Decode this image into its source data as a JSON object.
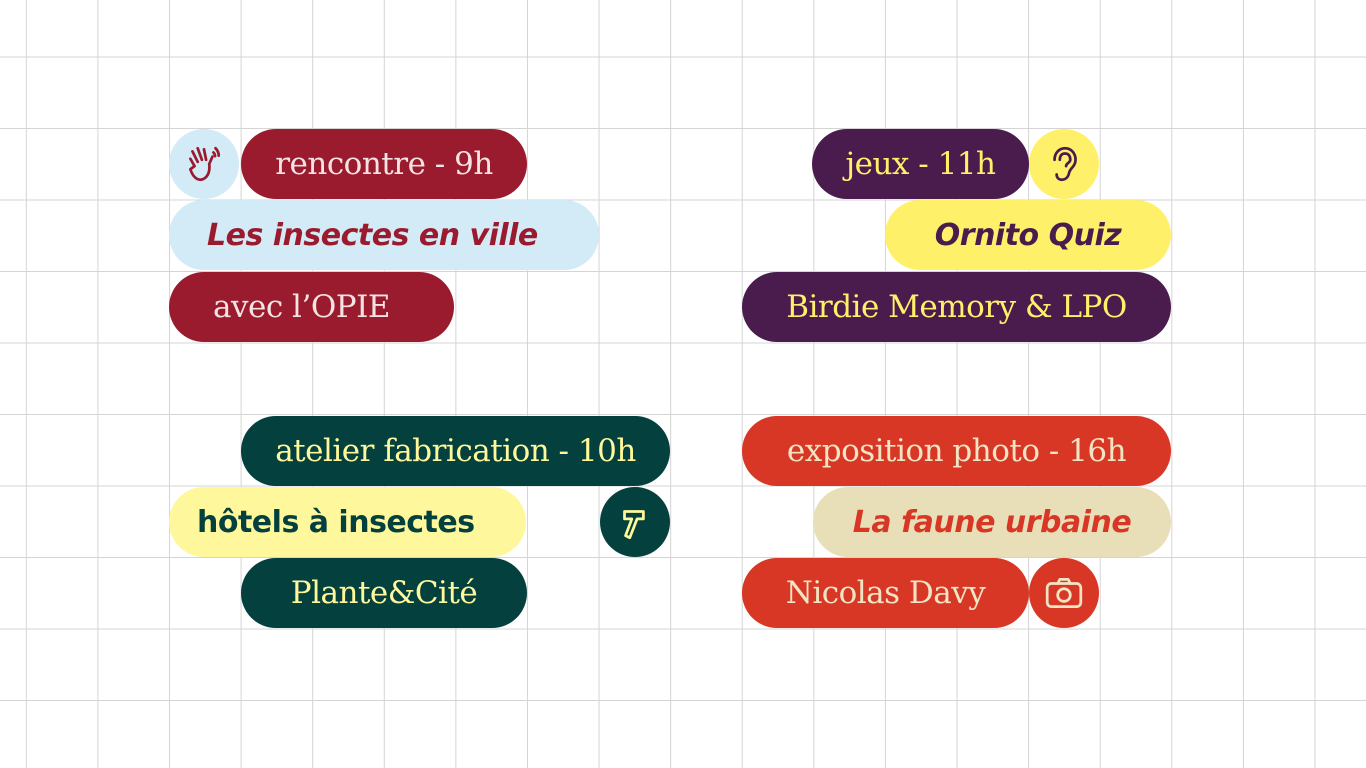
{
  "colors": {
    "crimson": "#9b1b2e",
    "light_blue": "#d3eaf7",
    "purple": "#4a1c4e",
    "yellow": "#fff06a",
    "dark_green": "#04403d",
    "pale_yellow": "#fff79b",
    "red_orange": "#d83725",
    "beige": "#e8dfb9",
    "grid": "#d4d4d4"
  },
  "events": [
    {
      "category": "rencontre - 9h",
      "title": "Les insectes en ville",
      "host": "avec l’OPIE",
      "icon": "waving-hand-icon"
    },
    {
      "category": "jeux - 11h",
      "title": "Ornito Quiz",
      "host": "Birdie Memory & LPO",
      "icon": "ear-icon"
    },
    {
      "category": "atelier fabrication - 10h",
      "title": "hôtels à insectes",
      "host": "Plante&Cité",
      "icon": "hammer-icon"
    },
    {
      "category": "exposition photo - 16h",
      "title": "La faune urbaine",
      "host": "Nicolas Davy",
      "icon": "camera-icon"
    }
  ]
}
